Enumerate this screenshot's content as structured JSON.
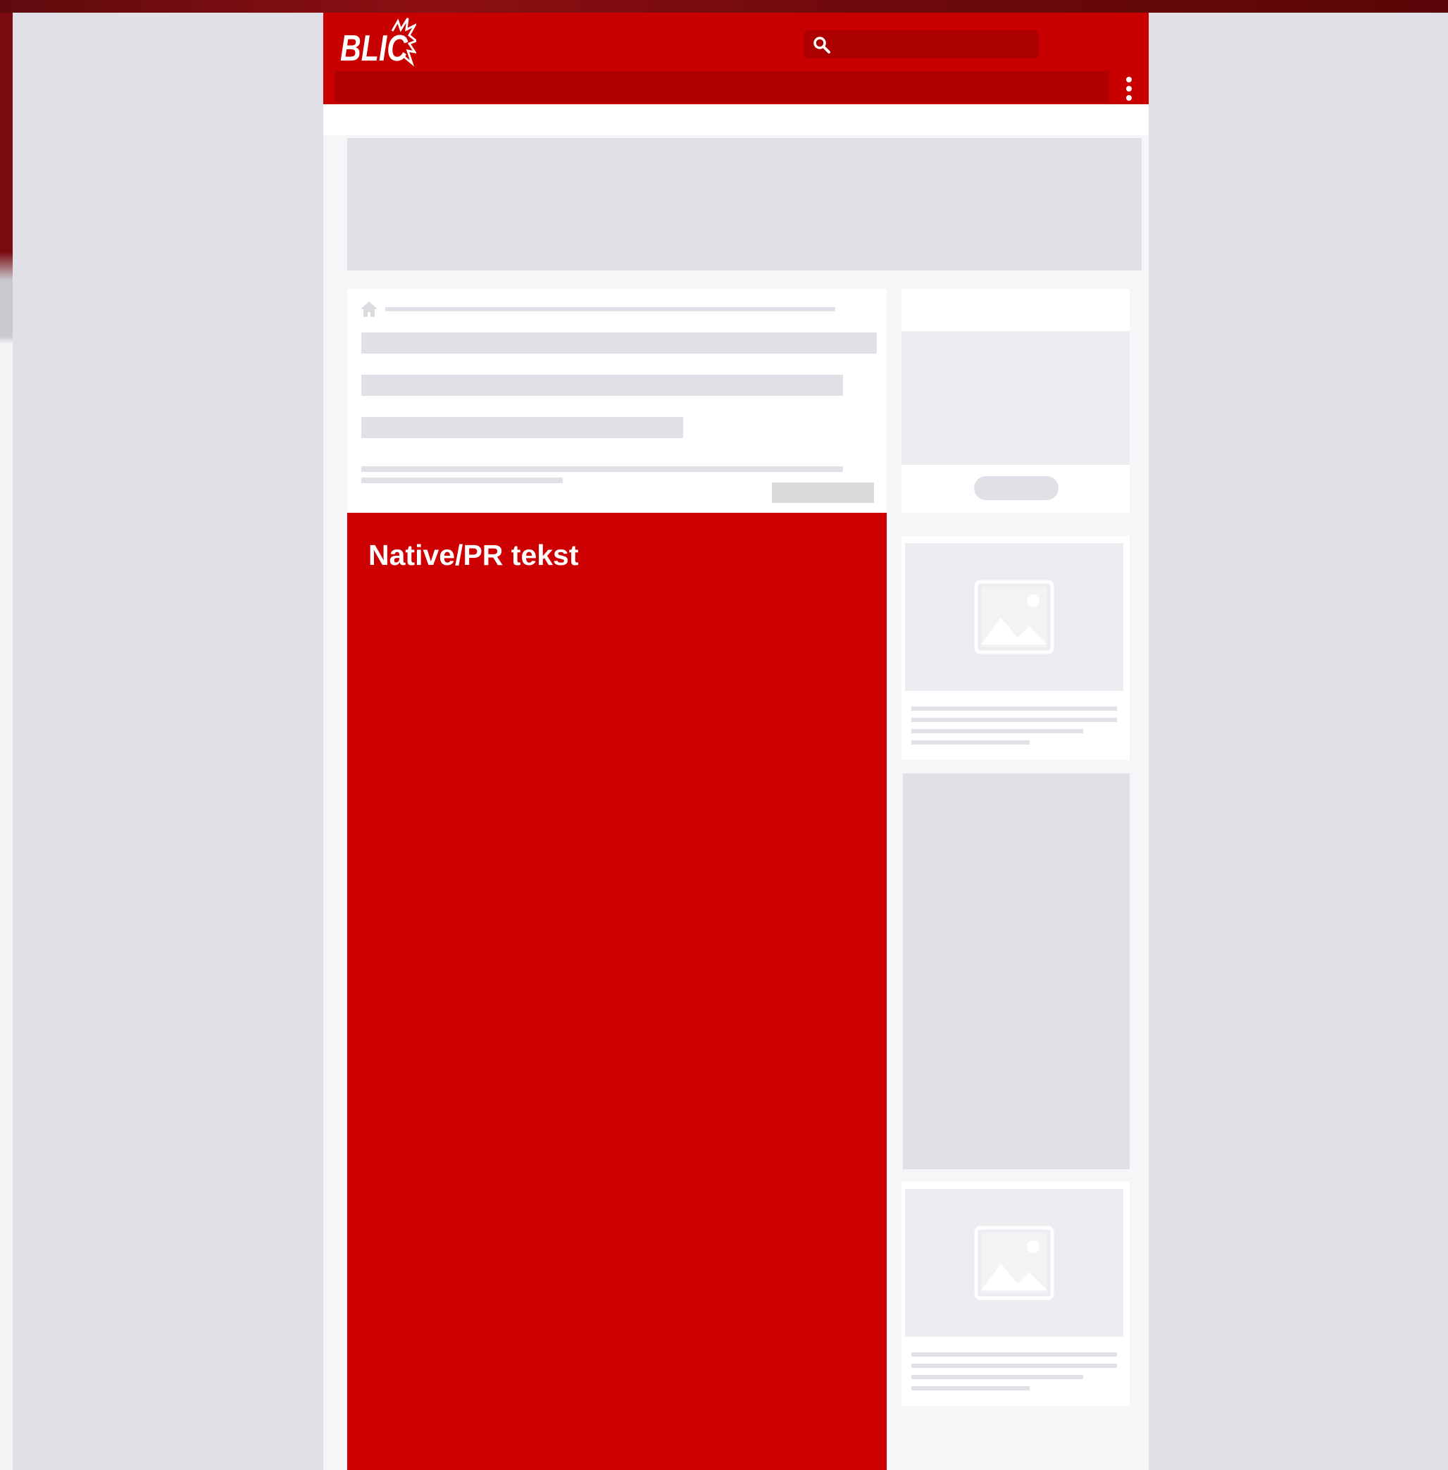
{
  "header": {
    "logo_text": "BLIC",
    "search": {
      "placeholder": "",
      "icon": "search-icon"
    },
    "menu_icon": "kebab-menu-icon"
  },
  "breadcrumb": {
    "icon": "home-icon"
  },
  "native_block": {
    "title": "Native/PR tekst"
  },
  "colors": {
    "brand_red": "#c80000",
    "nav_red": "#b00000",
    "search_red": "#ac0000",
    "native_red": "#cc0000",
    "placeholder_gray": "#e1e0e6",
    "page_bg": "#f6f6f8"
  }
}
